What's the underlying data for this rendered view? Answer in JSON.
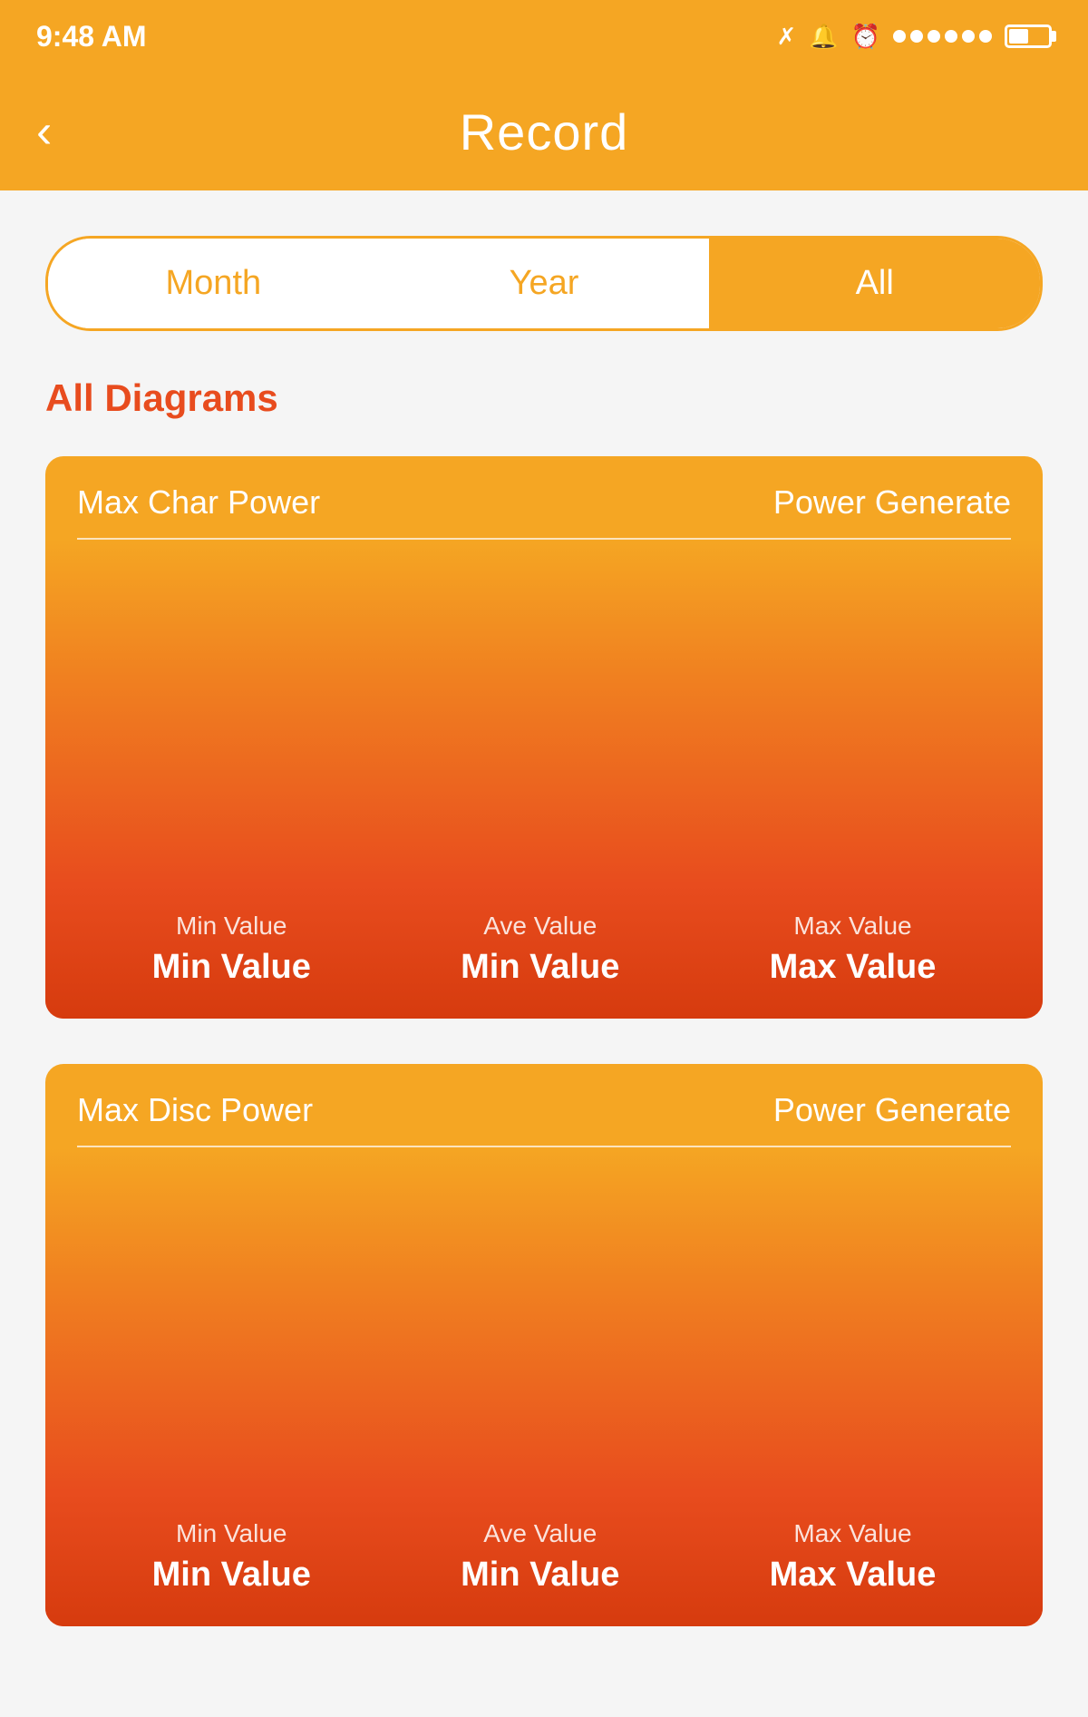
{
  "statusBar": {
    "time": "9:48 AM",
    "icons": [
      "bluetooth",
      "muted",
      "alarm",
      "signal",
      "battery"
    ]
  },
  "header": {
    "backLabel": "‹",
    "title": "Record"
  },
  "tabs": [
    {
      "label": "Month",
      "active": false
    },
    {
      "label": "Year",
      "active": false
    },
    {
      "label": "All",
      "active": true
    }
  ],
  "sectionTitle": "All Diagrams",
  "cards": [
    {
      "titleLeft": "Max Char Power",
      "titleRight": "Power Generate",
      "values": [
        {
          "label": "Min Value",
          "amount": "Min Value"
        },
        {
          "label": "Ave Value",
          "amount": "Min Value"
        },
        {
          "label": "Max Value",
          "amount": "Max Value"
        }
      ]
    },
    {
      "titleLeft": "Max Disc Power",
      "titleRight": "Power Generate",
      "values": [
        {
          "label": "Min Value",
          "amount": "Min Value"
        },
        {
          "label": "Ave Value",
          "amount": "Min Value"
        },
        {
          "label": "Max Value",
          "amount": "Max Value"
        }
      ]
    }
  ],
  "colors": {
    "orange": "#F5A623",
    "deepOrange": "#E84C1E",
    "red": "#D63B0E",
    "accent": "#E84C1E"
  }
}
